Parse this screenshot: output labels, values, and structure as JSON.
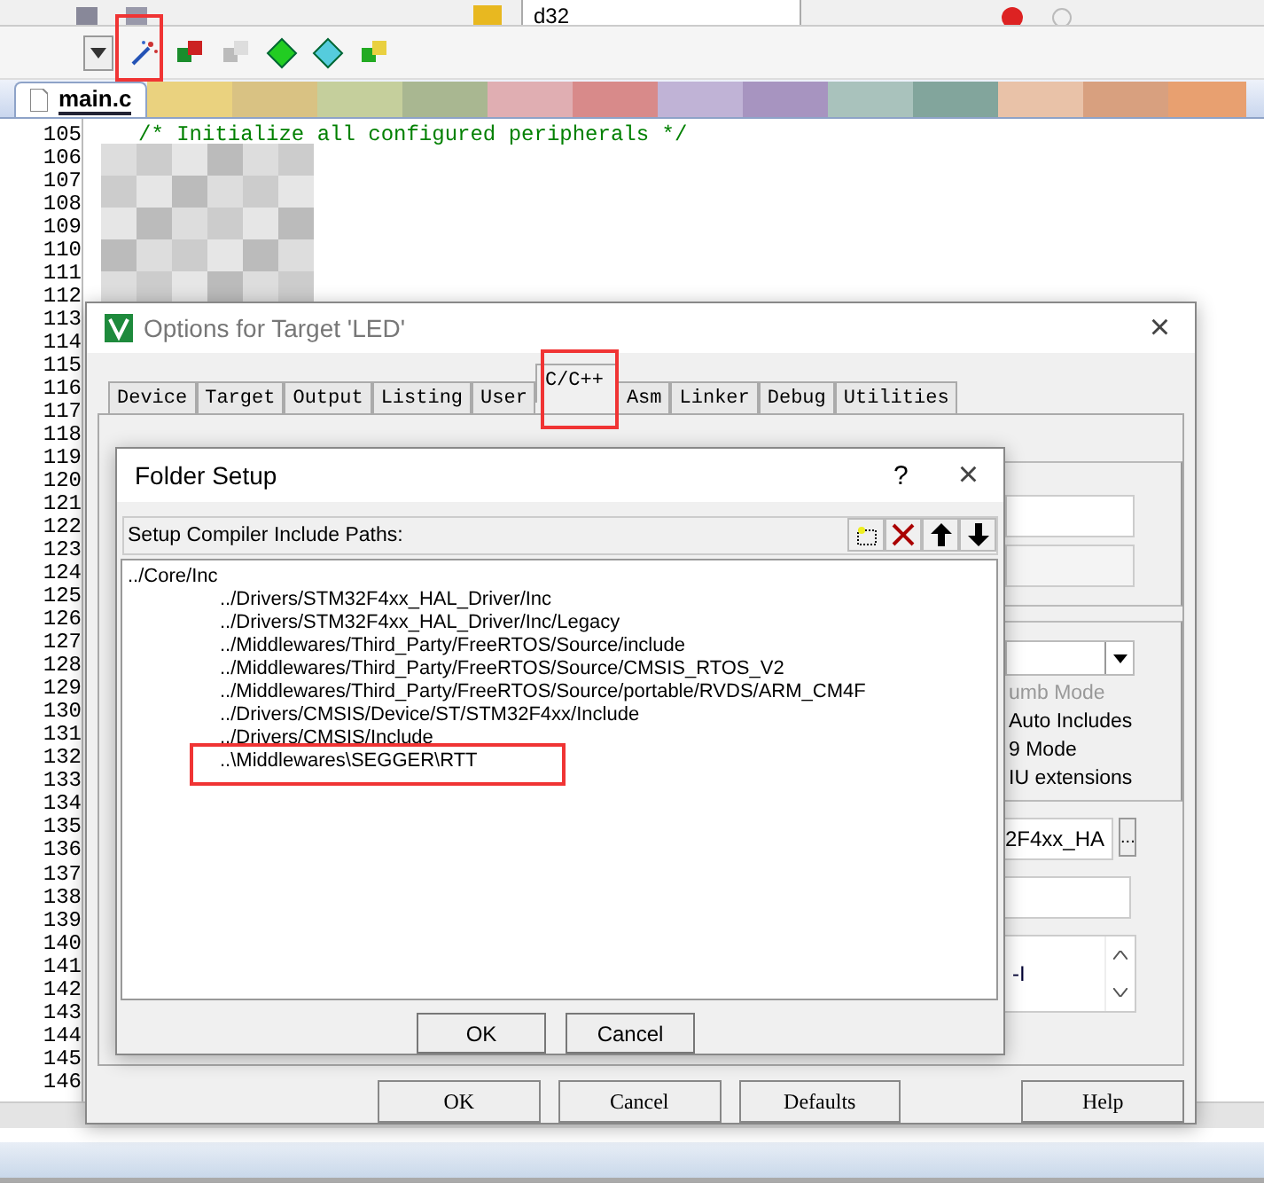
{
  "toolbar": {
    "target_combo": "d32"
  },
  "editor": {
    "tabs": [
      {
        "label": "main.c",
        "selected": true
      }
    ],
    "line_numbers": [
      "105",
      "106",
      "107",
      "108",
      "109",
      "110",
      "111",
      "112",
      "113",
      "114",
      "115",
      "116",
      "117",
      "118",
      "119",
      "120",
      "121",
      "122",
      "123",
      "124",
      "125",
      "126",
      "127",
      "128",
      "129",
      "130",
      "131",
      "132",
      "133",
      "134",
      "135",
      "136",
      "137",
      "138",
      "139",
      "140",
      "141",
      "142",
      "143",
      "144",
      "145",
      "146"
    ],
    "code_lines": [
      {
        "text": "/* Initialize all configured peripherals */",
        "kind": "comment"
      }
    ]
  },
  "options_dialog": {
    "title": "Options for Target 'LED'",
    "close_button": "×",
    "tabs": [
      {
        "label": "Device",
        "selected": false
      },
      {
        "label": "Target",
        "selected": false
      },
      {
        "label": "Output",
        "selected": false
      },
      {
        "label": "Listing",
        "selected": false
      },
      {
        "label": "User",
        "selected": false
      },
      {
        "label": "C/C++",
        "selected": true
      },
      {
        "label": "Asm",
        "selected": false
      },
      {
        "label": "Linker",
        "selected": false
      },
      {
        "label": "Debug",
        "selected": false
      },
      {
        "label": "Utilities",
        "selected": false
      }
    ],
    "options": [
      {
        "label": "umb Mode",
        "disabled": true
      },
      {
        "label": "Auto Includes",
        "disabled": false
      },
      {
        "label": "9 Mode",
        "disabled": false
      },
      {
        "label": "IU extensions",
        "disabled": false
      }
    ],
    "include_paths_value": "2F4xx_HA",
    "browse_button": "...",
    "misc_controls_value": "-I",
    "buttons": [
      "OK",
      "Cancel",
      "Defaults",
      "Help"
    ]
  },
  "folder_setup": {
    "title": "Folder Setup",
    "help_button": "?",
    "close_button": "×",
    "list_label": "Setup Compiler Include Paths:",
    "paths": [
      {
        "text": "../Core/Inc",
        "children": [
          {
            "text": "../Drivers/STM32F4xx_HAL_Driver/Inc"
          },
          {
            "text": "../Drivers/STM32F4xx_HAL_Driver/Inc/Legacy"
          },
          {
            "text": "../Middlewares/Third_Party/FreeRTOS/Source/include"
          },
          {
            "text": "../Middlewares/Third_Party/FreeRTOS/Source/CMSIS_RTOS_V2"
          },
          {
            "text": "../Middlewares/Third_Party/FreeRTOS/Source/portable/RVDS/ARM_CM4F"
          },
          {
            "text": "../Drivers/CMSIS/Device/ST/STM32F4xx/Include"
          },
          {
            "text": "../Drivers/CMSIS/Include"
          },
          {
            "text": "..\\Middlewares\\SEGGER\\RTT"
          }
        ]
      }
    ],
    "buttons": [
      "OK",
      "Cancel"
    ]
  }
}
